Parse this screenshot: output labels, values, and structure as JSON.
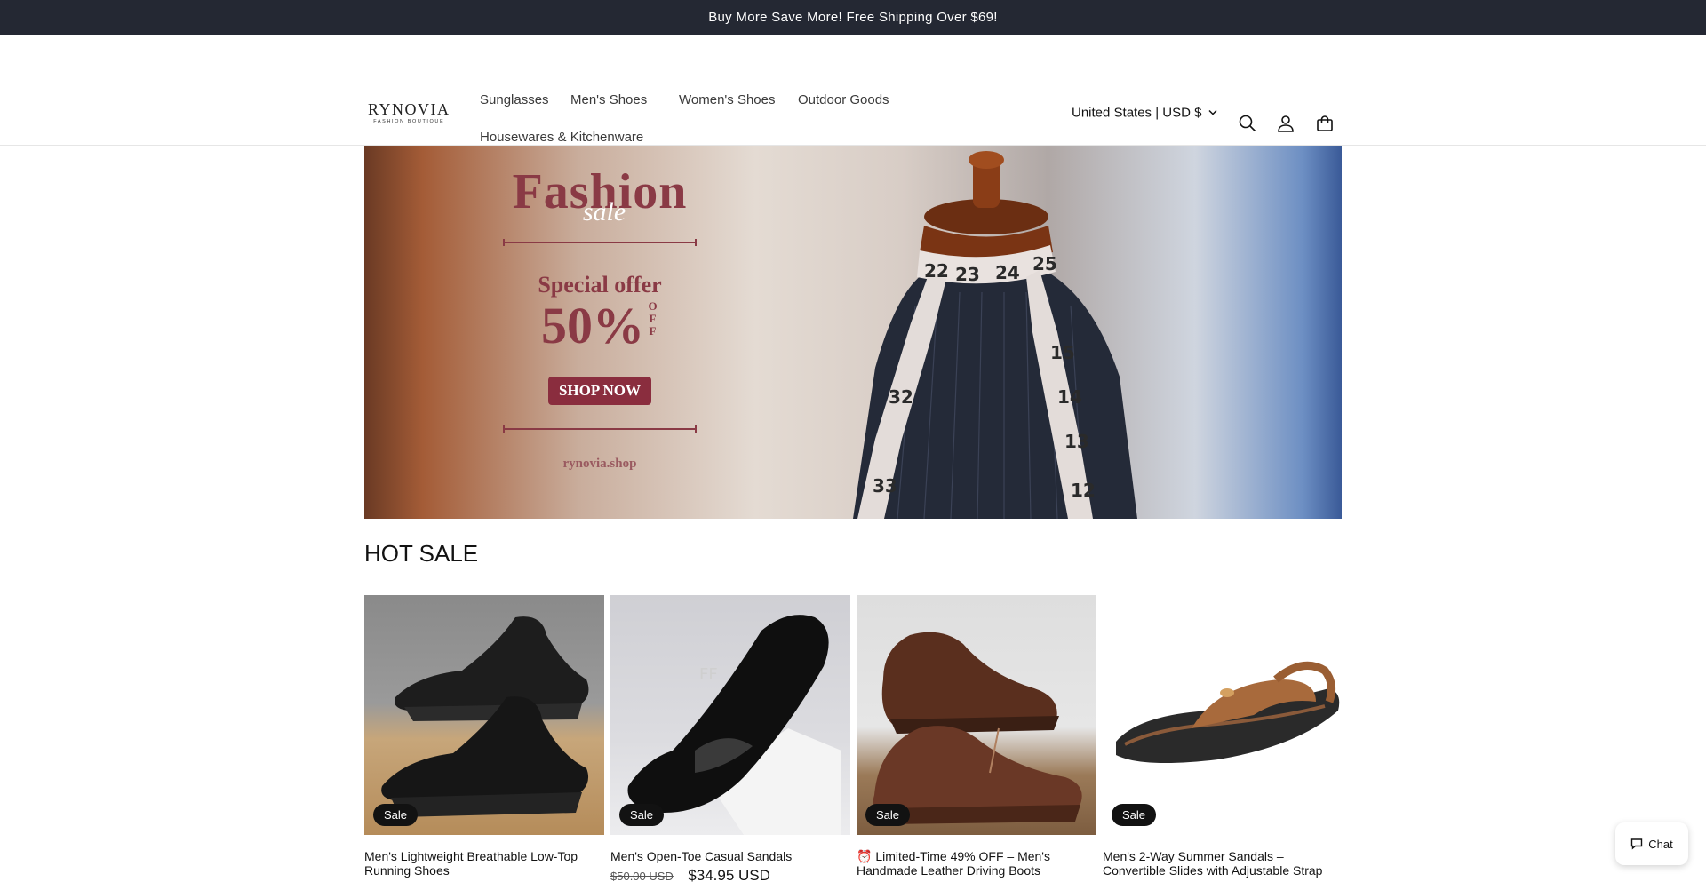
{
  "announcement": "Buy More Save More! Free Shipping Over $69!",
  "brand": {
    "name": "RYNOVIA",
    "tagline": "FASHION BOUTIQUE"
  },
  "nav": {
    "items": [
      {
        "label": "Sunglasses"
      },
      {
        "label": "Men's Shoes"
      },
      {
        "label": "Women's Shoes"
      },
      {
        "label": "Outdoor Goods"
      },
      {
        "label": "Housewares & Kitchenware"
      }
    ]
  },
  "header": {
    "locale": "United States | USD $",
    "icons": [
      "search-icon",
      "account-icon",
      "cart-icon"
    ]
  },
  "hero": {
    "headline": "Fashion",
    "script": "sale",
    "offer": "Special offer",
    "percent": "50%",
    "off": "OFF",
    "cta": "SHOP NOW",
    "site": "rynovia.shop",
    "tape_numbers": [
      "22",
      "23",
      "24",
      "25",
      "32",
      "33",
      "15",
      "14",
      "13",
      "12"
    ]
  },
  "section": {
    "title": "HOT SALE"
  },
  "products": [
    {
      "badge": "Sale",
      "title": "Men's Lightweight Breathable Low-Top Running Shoes",
      "price_was": "",
      "price_now": ""
    },
    {
      "badge": "Sale",
      "title": "Men's Open-Toe Casual Sandals",
      "price_was": "$50.00 USD",
      "price_now": "$34.95 USD"
    },
    {
      "badge": "Sale",
      "title": "⏰ Limited-Time 49% OFF – Men's Handmade Leather Driving Boots",
      "price_was": "",
      "price_now": ""
    },
    {
      "badge": "Sale",
      "title": "Men's 2-Way Summer Sandals – Convertible Slides with Adjustable Strap",
      "price_was": "",
      "price_now": ""
    }
  ],
  "chat": {
    "label": "Chat"
  },
  "colors": {
    "announce_bg": "#242833",
    "badge_bg": "#121212",
    "promo_accent": "#8a3a45"
  }
}
